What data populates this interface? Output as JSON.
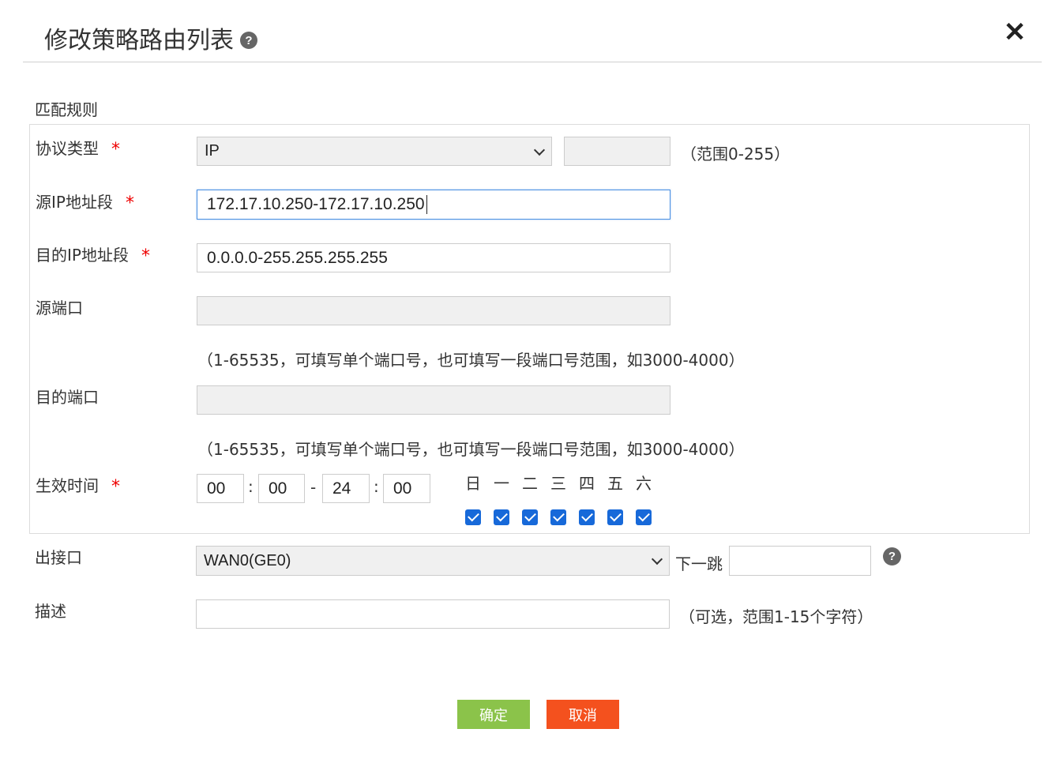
{
  "dialog": {
    "title": "修改策略路由列表",
    "help_glyph": "?",
    "close_glyph": "✕"
  },
  "section_title": "匹配规则",
  "required_mark": "*",
  "protocol": {
    "label": "协议类型",
    "selected": "IP",
    "number_value": "",
    "range_hint": "（范围0-255）"
  },
  "src_ip": {
    "label": "源IP地址段",
    "value": "172.17.10.250-172.17.10.250"
  },
  "dst_ip": {
    "label": "目的IP地址段",
    "value": "0.0.0.0-255.255.255.255"
  },
  "src_port": {
    "label": "源端口",
    "value": "",
    "hint": "（1-65535，可填写单个端口号，也可填写一段端口号范围，如3000-4000）"
  },
  "dst_port": {
    "label": "目的端口",
    "value": "",
    "hint": "（1-65535，可填写单个端口号，也可填写一段端口号范围，如3000-4000）"
  },
  "effective_time": {
    "label": "生效时间",
    "start_hour": "00",
    "start_minute": "00",
    "end_hour": "24",
    "end_minute": "00",
    "colon": ":",
    "dash": "-",
    "days": [
      "日",
      "一",
      "二",
      "三",
      "四",
      "五",
      "六"
    ],
    "days_checked": [
      true,
      true,
      true,
      true,
      true,
      true,
      true
    ]
  },
  "out_interface": {
    "label": "出接口",
    "selected": "WAN0(GE0)",
    "next_hop_label": "下一跳",
    "next_hop_value": ""
  },
  "description": {
    "label": "描述",
    "value": "",
    "hint": "（可选，范围1-15个字符）"
  },
  "buttons": {
    "confirm": "确定",
    "cancel": "取消"
  },
  "colors": {
    "confirm": "#8bc34a",
    "cancel": "#f4511e",
    "required": "#e00000",
    "checkbox": "#1769d9"
  }
}
